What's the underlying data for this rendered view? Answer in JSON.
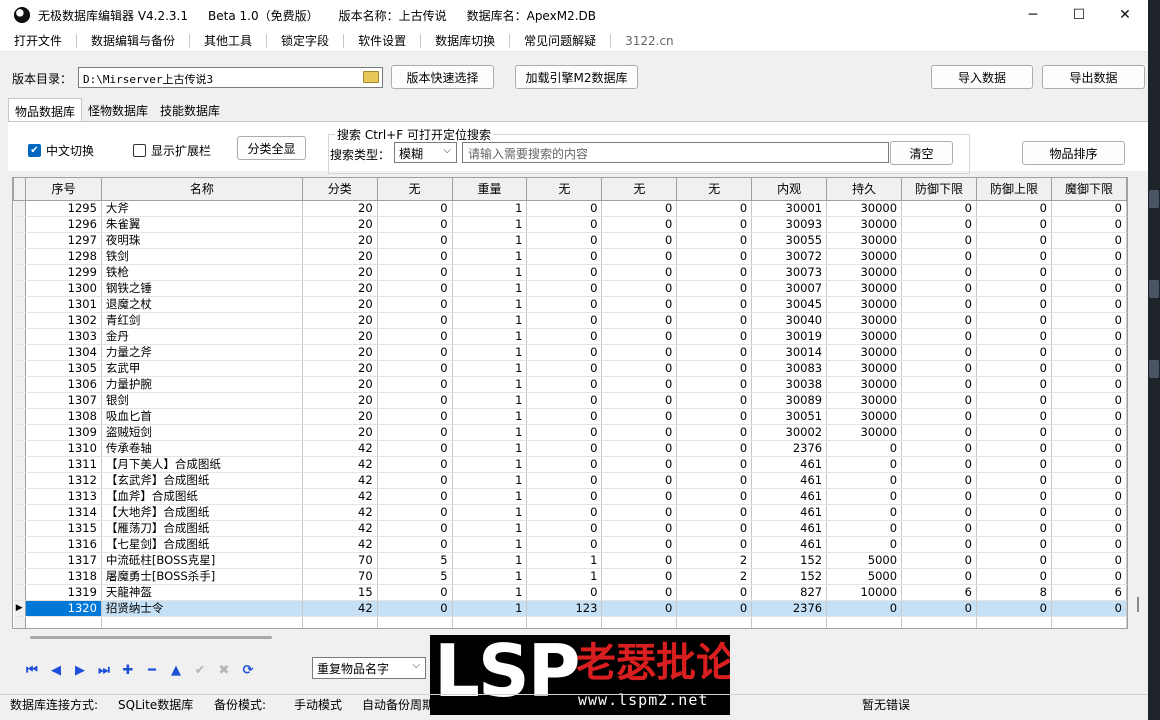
{
  "titlebar": {
    "app_name": "无极数据库编辑器 V4.2.3.1",
    "edition": "Beta 1.0（免费版）",
    "version_label": "版本名称：上古传说",
    "db_label": "数据库名：ApexM2.DB",
    "minimize": "─",
    "maximize": "☐",
    "close": "✕"
  },
  "menu": [
    "打开文件",
    "数据编辑与备份",
    "其他工具",
    "锁定字段",
    "软件设置",
    "数据库切换",
    "常见问题解疑",
    "3122.cn"
  ],
  "toolbar": {
    "dir_label": "版本目录：",
    "dir_value": "D:\\Mirserver上古传说3",
    "quick_select": "版本快速选择",
    "load_engine": "加载引擎M2数据库",
    "import": "导入数据",
    "export": "导出数据"
  },
  "tabs": [
    "物品数据库",
    "怪物数据库",
    "技能数据库"
  ],
  "options": {
    "chinese_switch": "中文切换",
    "show_ext": "显示扩展栏",
    "category_all": "分类全显",
    "search_title": "搜索  Ctrl+F 可打开定位搜索",
    "search_type_label": "搜索类型：",
    "search_type_value": "模糊",
    "search_placeholder": "请输入需要搜索的内容",
    "clear": "清空",
    "sort": "物品排序"
  },
  "grid": {
    "columns": [
      "序号",
      "名称",
      "分类",
      "无",
      "重量",
      "无",
      "无",
      "无",
      "内观",
      "持久",
      "防御下限",
      "防御上限",
      "魔御下限"
    ],
    "rows": [
      [
        "1295",
        "大斧",
        "20",
        "0",
        "1",
        "0",
        "0",
        "0",
        "30001",
        "30000",
        "0",
        "0",
        "0"
      ],
      [
        "1296",
        "朱雀翼",
        "20",
        "0",
        "1",
        "0",
        "0",
        "0",
        "30093",
        "30000",
        "0",
        "0",
        "0"
      ],
      [
        "1297",
        "夜明珠",
        "20",
        "0",
        "1",
        "0",
        "0",
        "0",
        "30055",
        "30000",
        "0",
        "0",
        "0"
      ],
      [
        "1298",
        "铁剑",
        "20",
        "0",
        "1",
        "0",
        "0",
        "0",
        "30072",
        "30000",
        "0",
        "0",
        "0"
      ],
      [
        "1299",
        "铁枪",
        "20",
        "0",
        "1",
        "0",
        "0",
        "0",
        "30073",
        "30000",
        "0",
        "0",
        "0"
      ],
      [
        "1300",
        "钢铁之锤",
        "20",
        "0",
        "1",
        "0",
        "0",
        "0",
        "30007",
        "30000",
        "0",
        "0",
        "0"
      ],
      [
        "1301",
        "退魔之杖",
        "20",
        "0",
        "1",
        "0",
        "0",
        "0",
        "30045",
        "30000",
        "0",
        "0",
        "0"
      ],
      [
        "1302",
        "青红剑",
        "20",
        "0",
        "1",
        "0",
        "0",
        "0",
        "30040",
        "30000",
        "0",
        "0",
        "0"
      ],
      [
        "1303",
        "金丹",
        "20",
        "0",
        "1",
        "0",
        "0",
        "0",
        "30019",
        "30000",
        "0",
        "0",
        "0"
      ],
      [
        "1304",
        "力量之斧",
        "20",
        "0",
        "1",
        "0",
        "0",
        "0",
        "30014",
        "30000",
        "0",
        "0",
        "0"
      ],
      [
        "1305",
        "玄武甲",
        "20",
        "0",
        "1",
        "0",
        "0",
        "0",
        "30083",
        "30000",
        "0",
        "0",
        "0"
      ],
      [
        "1306",
        "力量护腕",
        "20",
        "0",
        "1",
        "0",
        "0",
        "0",
        "30038",
        "30000",
        "0",
        "0",
        "0"
      ],
      [
        "1307",
        "银剑",
        "20",
        "0",
        "1",
        "0",
        "0",
        "0",
        "30089",
        "30000",
        "0",
        "0",
        "0"
      ],
      [
        "1308",
        "吸血匕首",
        "20",
        "0",
        "1",
        "0",
        "0",
        "0",
        "30051",
        "30000",
        "0",
        "0",
        "0"
      ],
      [
        "1309",
        "盗贼短剑",
        "20",
        "0",
        "1",
        "0",
        "0",
        "0",
        "30002",
        "30000",
        "0",
        "0",
        "0"
      ],
      [
        "1310",
        "传承卷轴",
        "42",
        "0",
        "1",
        "0",
        "0",
        "0",
        "2376",
        "0",
        "0",
        "0",
        "0"
      ],
      [
        "1311",
        "【月下美人】合成图纸",
        "42",
        "0",
        "1",
        "0",
        "0",
        "0",
        "461",
        "0",
        "0",
        "0",
        "0"
      ],
      [
        "1312",
        "【玄武斧】合成图纸",
        "42",
        "0",
        "1",
        "0",
        "0",
        "0",
        "461",
        "0",
        "0",
        "0",
        "0"
      ],
      [
        "1313",
        "【血斧】合成图纸",
        "42",
        "0",
        "1",
        "0",
        "0",
        "0",
        "461",
        "0",
        "0",
        "0",
        "0"
      ],
      [
        "1314",
        "【大地斧】合成图纸",
        "42",
        "0",
        "1",
        "0",
        "0",
        "0",
        "461",
        "0",
        "0",
        "0",
        "0"
      ],
      [
        "1315",
        "【雁荡刀】合成图纸",
        "42",
        "0",
        "1",
        "0",
        "0",
        "0",
        "461",
        "0",
        "0",
        "0",
        "0"
      ],
      [
        "1316",
        "【七星剑】合成图纸",
        "42",
        "0",
        "1",
        "0",
        "0",
        "0",
        "461",
        "0",
        "0",
        "0",
        "0"
      ],
      [
        "1317",
        "中流砥柱[BOSS克星]",
        "70",
        "5",
        "1",
        "1",
        "0",
        "2",
        "152",
        "5000",
        "0",
        "0",
        "0"
      ],
      [
        "1318",
        "屠魔勇士[BOSS杀手]",
        "70",
        "5",
        "1",
        "1",
        "0",
        "2",
        "152",
        "5000",
        "0",
        "0",
        "0"
      ],
      [
        "1319",
        "天龍神盔",
        "15",
        "0",
        "1",
        "0",
        "0",
        "0",
        "827",
        "10000",
        "6",
        "8",
        "6"
      ],
      [
        "1320",
        "招贤纳士令",
        "42",
        "0",
        "1",
        "123",
        "0",
        "0",
        "2376",
        "0",
        "0",
        "0",
        "0"
      ]
    ],
    "selected_row": 25,
    "row_marker": "▶"
  },
  "nav": {
    "icons": [
      "first-icon",
      "prev-icon",
      "next-icon",
      "last-icon",
      "add-icon",
      "delete-icon",
      "up-icon",
      "check-icon",
      "cancel-icon",
      "refresh-icon"
    ],
    "glyphs": [
      "⏮",
      "◀",
      "▶",
      "⏭",
      "✚",
      "━",
      "▲",
      "✔",
      "✖",
      "⟳"
    ],
    "dup_select": "重复物品名字"
  },
  "watermark": {
    "lsp": "LSP",
    "cn": "老瑟批论坛",
    "url": "www.lspm2.net"
  },
  "status": {
    "conn_label": "数据库连接方式:",
    "conn_value": "SQLite数据库",
    "backup_label": "备份模式:",
    "backup_value": "手动模式",
    "auto_label": "自动备份周期:",
    "error": "暂无错误"
  },
  "colors": {
    "accent": "#0078d7",
    "selected_row": "#c6e0f5",
    "watermark_red": "#d81e1e",
    "nav_blue": "#1d4fd8"
  }
}
